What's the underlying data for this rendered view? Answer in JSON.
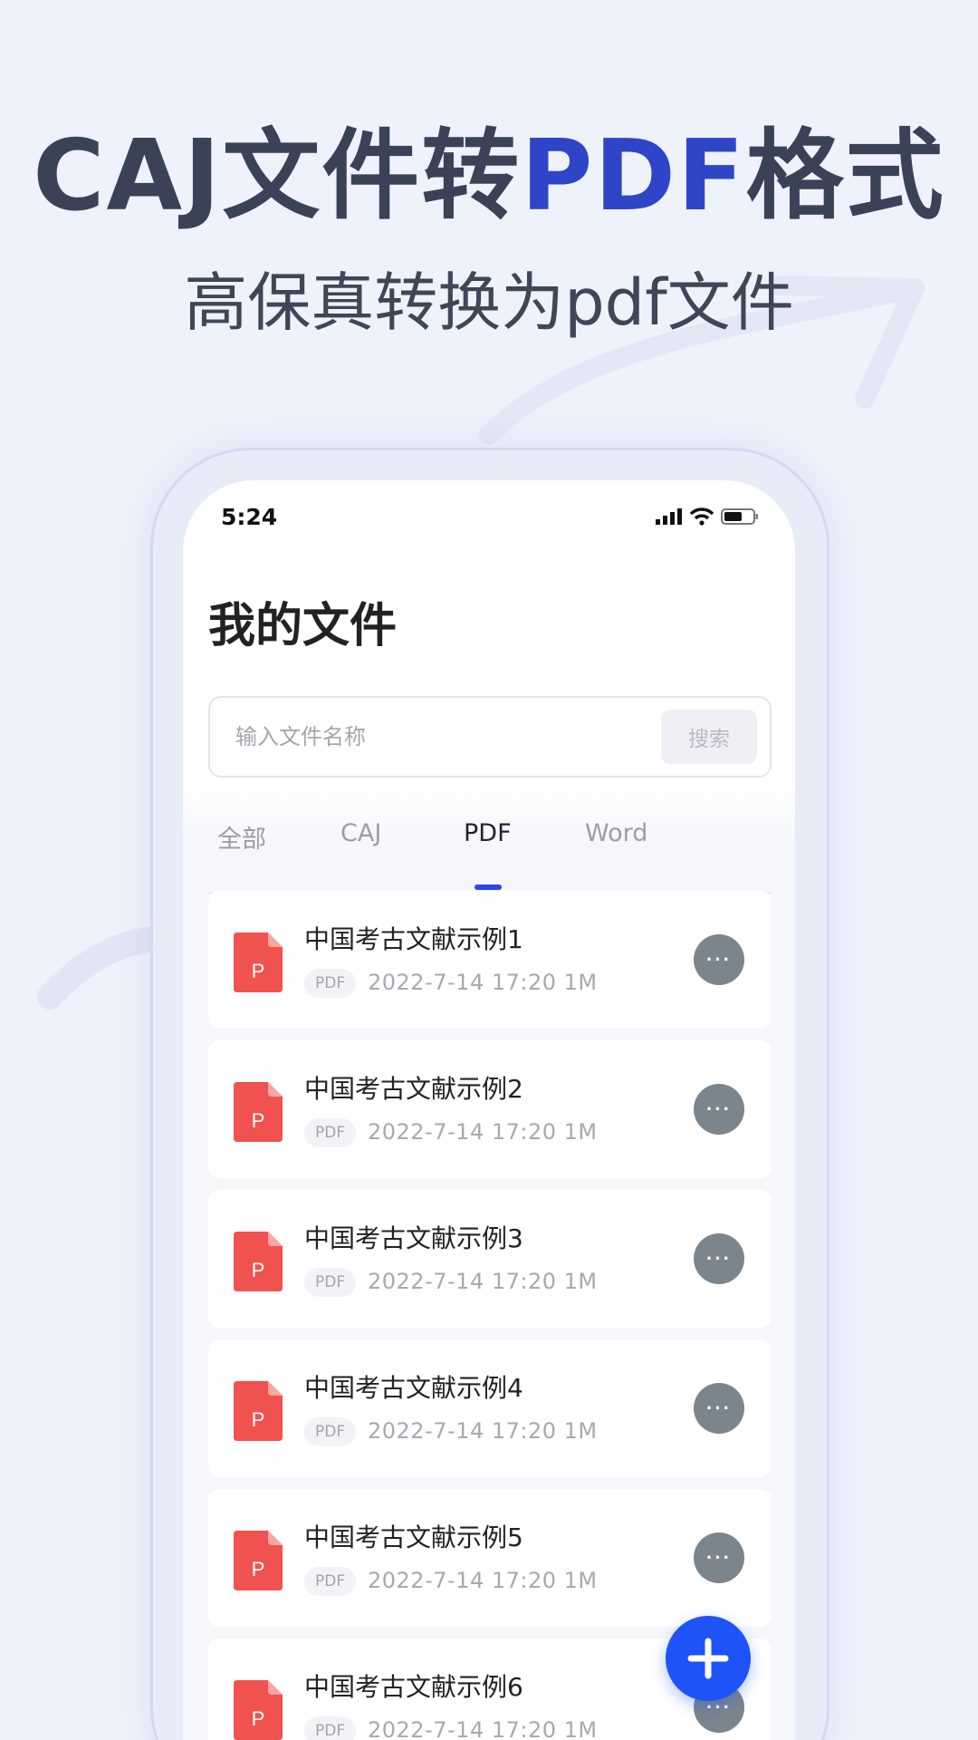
{
  "hero": {
    "title_part1": "CAJ文件转",
    "title_accent": "PDF",
    "title_part2": "格式",
    "subtitle": "高保真转换为pdf文件"
  },
  "status_bar": {
    "time": "5:24"
  },
  "page": {
    "title": "我的文件"
  },
  "search": {
    "placeholder": "输入文件名称",
    "button_label": "搜索"
  },
  "tabs": [
    {
      "label": "全部",
      "active": false
    },
    {
      "label": "CAJ",
      "active": false
    },
    {
      "label": "PDF",
      "active": true
    },
    {
      "label": "Word",
      "active": false
    }
  ],
  "files": [
    {
      "name": "中国考古文献示例1",
      "tag": "PDF",
      "meta": "2022-7-14  17:20  1M"
    },
    {
      "name": "中国考古文献示例2",
      "tag": "PDF",
      "meta": "2022-7-14  17:20  1M"
    },
    {
      "name": "中国考古文献示例3",
      "tag": "PDF",
      "meta": "2022-7-14  17:20  1M"
    },
    {
      "name": "中国考古文献示例4",
      "tag": "PDF",
      "meta": "2022-7-14  17:20  1M"
    },
    {
      "name": "中国考古文献示例5",
      "tag": "PDF",
      "meta": "2022-7-14  17:20  1M"
    },
    {
      "name": "中国考古文献示例6",
      "tag": "PDF",
      "meta": "2022-7-14  17:20  1M"
    }
  ],
  "file_icon_letter": "P",
  "more_label": "···",
  "colors": {
    "accent": "#2f45c8",
    "primary": "#1d53f7",
    "file_icon": "#f0524f"
  },
  "icons": {
    "fab": "plus-icon",
    "more": "more-dots-icon"
  }
}
